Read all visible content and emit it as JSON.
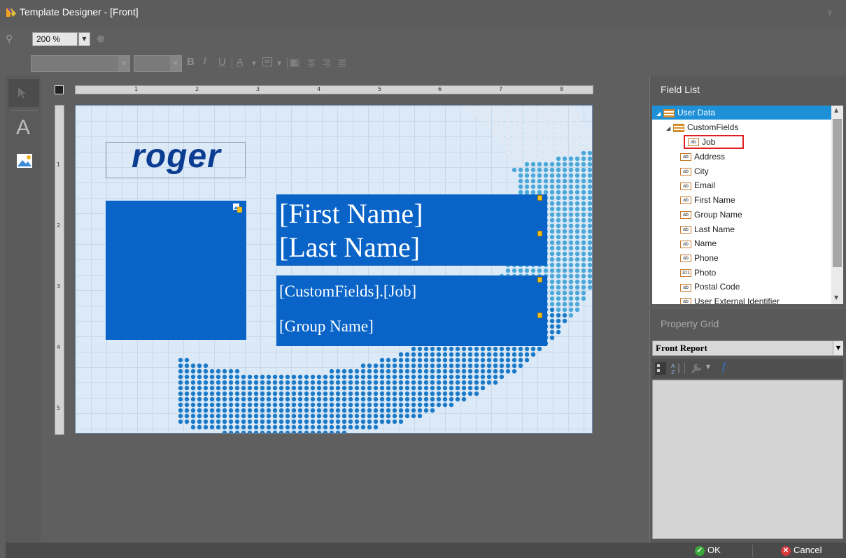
{
  "window": {
    "title": "Template Designer - [Front]",
    "help": "?",
    "app_icon": "template-designer-icon"
  },
  "zoom": {
    "value": "200 %"
  },
  "format_toolbar": {
    "bold": "B",
    "italic": "I",
    "underline": "U",
    "font_color": "A",
    "highlight_color": "ab"
  },
  "toolbox": {
    "text_tool": "A"
  },
  "rulers": {
    "top_labels": [
      "1",
      "2",
      "3",
      "4",
      "5",
      "6",
      "7",
      "8"
    ],
    "left_labels": [
      "1",
      "2",
      "3",
      "4",
      "5"
    ]
  },
  "canvas": {
    "logo": "roger",
    "first_name": "[First Name]",
    "last_name": "[Last Name]",
    "job": "[CustomFields].[Job]",
    "group_name": "[Group Name]"
  },
  "field_list": {
    "title": "Field List",
    "root": "User Data",
    "group": "CustomFields",
    "group_items": [
      "Job"
    ],
    "items": [
      {
        "label": "Address",
        "icon": "ab"
      },
      {
        "label": "City",
        "icon": "ab"
      },
      {
        "label": "Email",
        "icon": "ab"
      },
      {
        "label": "First Name",
        "icon": "ab"
      },
      {
        "label": "Group Name",
        "icon": "ab"
      },
      {
        "label": "Last Name",
        "icon": "ab"
      },
      {
        "label": "Name",
        "icon": "ab"
      },
      {
        "label": "Phone",
        "icon": "ab"
      },
      {
        "label": "Photo",
        "icon": "101"
      },
      {
        "label": "Postal Code",
        "icon": "ab"
      },
      {
        "label": "User External Identifier",
        "icon": "ab"
      }
    ],
    "highlight_color": "#e02020",
    "selected_color": "#1e90d8"
  },
  "property_grid": {
    "title": "Property Grid",
    "selected_object": "Front  Report"
  },
  "buttons": {
    "ok": "OK",
    "cancel": "Cancel"
  }
}
